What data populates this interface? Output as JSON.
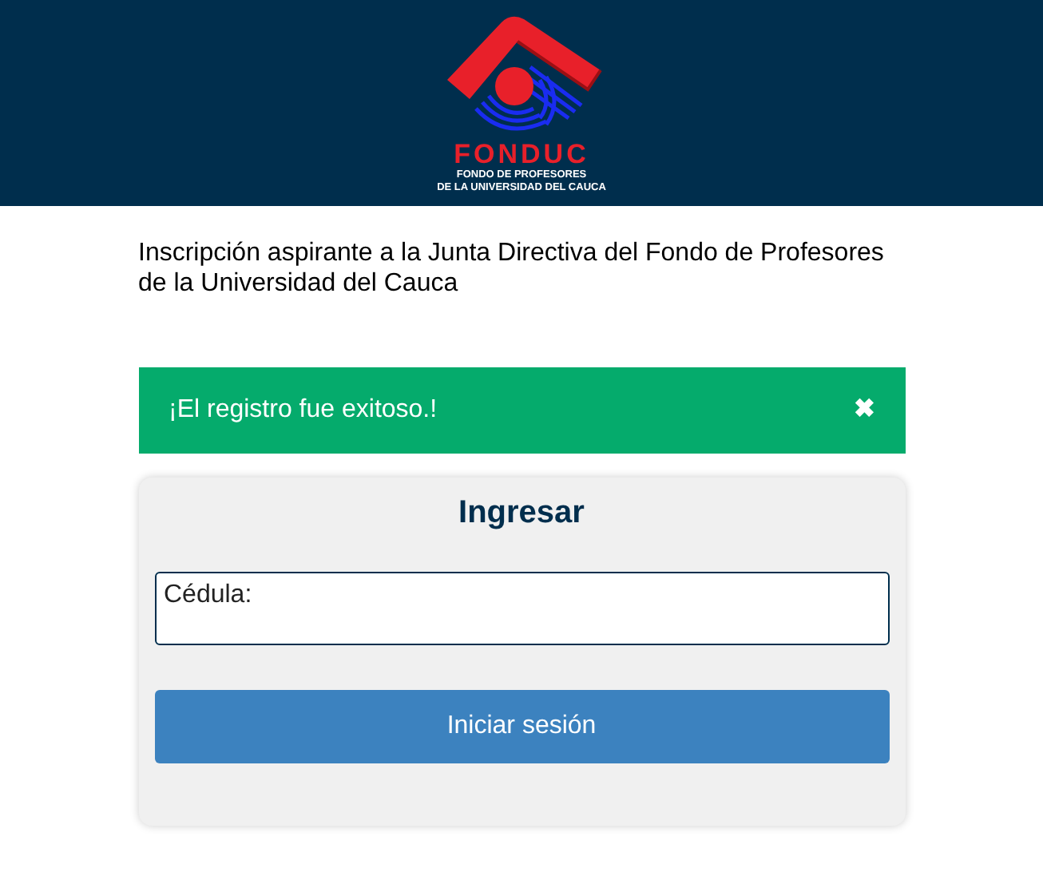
{
  "header": {
    "logo_name": "FONDUC",
    "logo_subtitle_lines": [
      "FONDO DE PROFESORES",
      "DE LA UNIVERSIDAD DEL CAUCA"
    ]
  },
  "intro": "Inscripción aspirante a la Junta Directiva del Fondo de Profesores de la Universidad del Cauca",
  "alert": {
    "message": "¡El registro fue exitoso.!",
    "close": "✖"
  },
  "login": {
    "title": "Ingresar",
    "field_label": "Cédula:",
    "button": "Iniciar sesión"
  }
}
